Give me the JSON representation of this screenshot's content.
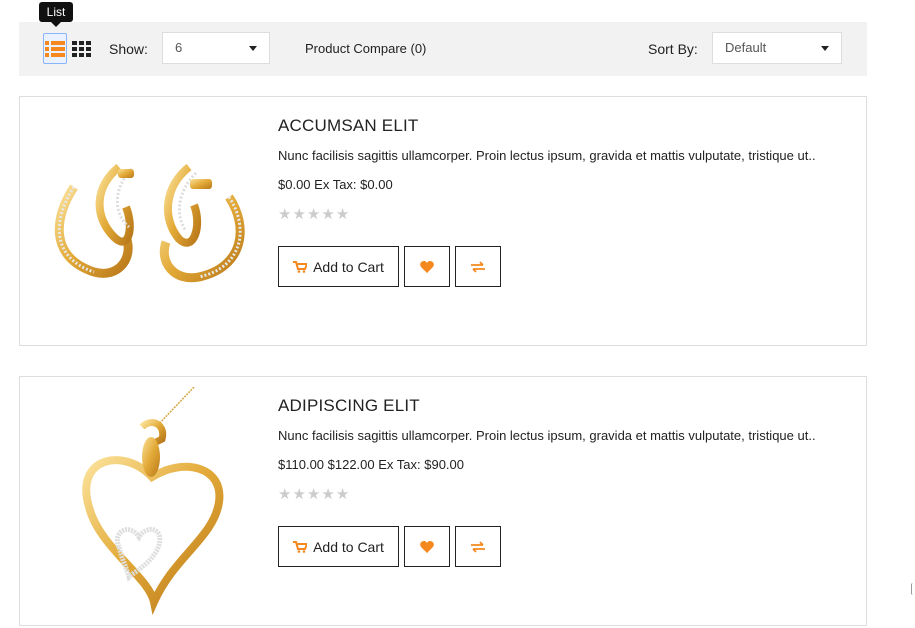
{
  "tooltip": {
    "text": "List"
  },
  "toolbar": {
    "show_label": "Show:",
    "show_value": "6",
    "compare_text": "Product Compare (0)",
    "sort_label": "Sort By:",
    "sort_value": "Default"
  },
  "colors": {
    "accent": "#f5891f",
    "border": "#dddddd",
    "toolbar_bg": "#f2f2f2"
  },
  "icons": {
    "list_view": "list-view-icon",
    "grid_view": "grid-view-icon",
    "cart": "cart-icon",
    "wishlist": "heart-icon",
    "compare": "compare-arrows-icon",
    "rating": "star-icon"
  },
  "products": [
    {
      "title": "ACCUMSAN ELIT",
      "description": "Nunc facilisis sagittis ullamcorper. Proin lectus ipsum, gravida et mattis vulputate, tristique ut..",
      "price": "$0.00 Ex Tax: $0.00",
      "rating": 0,
      "add_to_cart": "Add to Cart",
      "image": "gold diamond earrings"
    },
    {
      "title": "ADIPISCING ELIT",
      "description": "Nunc facilisis sagittis ullamcorper. Proin lectus ipsum, gravida et mattis vulputate, tristique ut..",
      "price": "$110.00 $122.00 Ex Tax: $90.00",
      "rating": 0,
      "add_to_cart": "Add to Cart",
      "image": "gold heart pendant"
    }
  ]
}
